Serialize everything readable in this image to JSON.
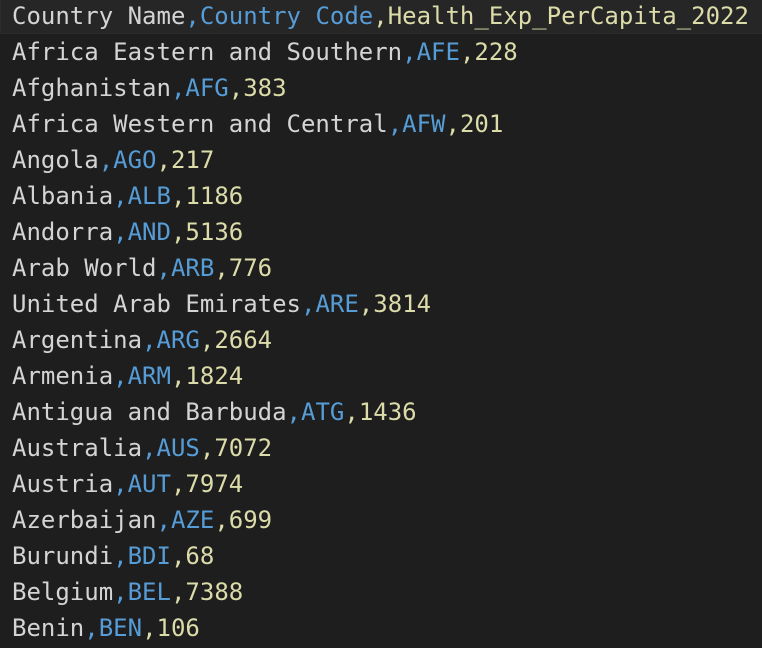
{
  "colors": {
    "background": "#1e1e1e",
    "column1": "#d4d4d4",
    "column2": "#569cd6",
    "column3": "#dcdcaa"
  },
  "rows": [
    [
      "Country Name",
      "Country Code",
      "Health_Exp_PerCapita_2022"
    ],
    [
      "Africa Eastern and Southern",
      "AFE",
      "228"
    ],
    [
      "Afghanistan",
      "AFG",
      "383"
    ],
    [
      "Africa Western and Central",
      "AFW",
      "201"
    ],
    [
      "Angola",
      "AGO",
      "217"
    ],
    [
      "Albania",
      "ALB",
      "1186"
    ],
    [
      "Andorra",
      "AND",
      "5136"
    ],
    [
      "Arab World",
      "ARB",
      "776"
    ],
    [
      "United Arab Emirates",
      "ARE",
      "3814"
    ],
    [
      "Argentina",
      "ARG",
      "2664"
    ],
    [
      "Armenia",
      "ARM",
      "1824"
    ],
    [
      "Antigua and Barbuda",
      "ATG",
      "1436"
    ],
    [
      "Australia",
      "AUS",
      "7072"
    ],
    [
      "Austria",
      "AUT",
      "7974"
    ],
    [
      "Azerbaijan",
      "AZE",
      "699"
    ],
    [
      "Burundi",
      "BDI",
      "68"
    ],
    [
      "Belgium",
      "BEL",
      "7388"
    ],
    [
      "Benin",
      "BEN",
      "106"
    ]
  ]
}
